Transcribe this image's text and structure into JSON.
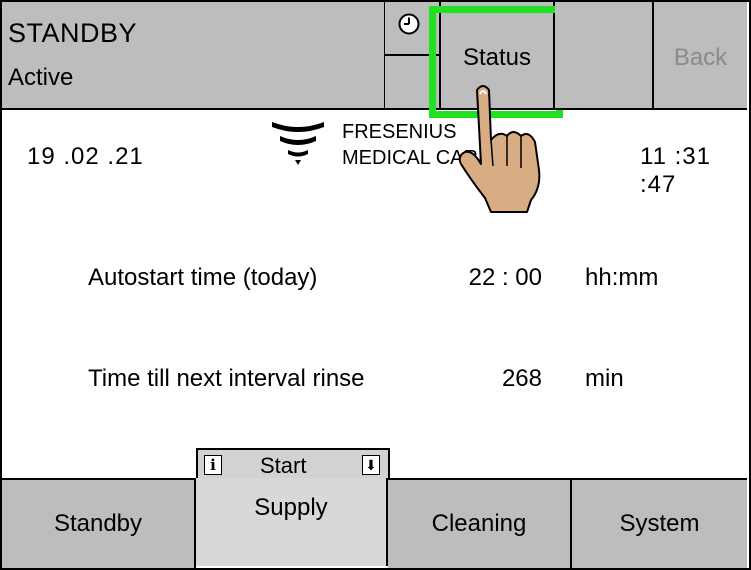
{
  "header": {
    "title": "STANDBY",
    "subtitle": "Active",
    "status_label": "Status",
    "back_label": "Back",
    "clock_icon": "clock-icon"
  },
  "info": {
    "date": "19 .02 .21",
    "time": "11 :31 :47",
    "logo_line1": "FRESENIUS",
    "logo_line2": "MEDICAL CARE"
  },
  "rows": [
    {
      "label": "Autostart time (today)",
      "value": "22 : 00",
      "unit": "hh:mm"
    },
    {
      "label": "Time till next interval rinse",
      "value": "268",
      "unit": "min"
    }
  ],
  "subtab": {
    "label": "Start",
    "info_icon": "i",
    "down_icon": "⬇"
  },
  "tabs": [
    {
      "label": "Standby"
    },
    {
      "label": "Supply"
    },
    {
      "label": "Cleaning"
    },
    {
      "label": "System"
    }
  ],
  "colors": {
    "button_gray": "#bdbdbd",
    "highlight_green": "#22e022",
    "disabled_text": "#8a8a8a",
    "hand_skin": "#d8ad84"
  }
}
